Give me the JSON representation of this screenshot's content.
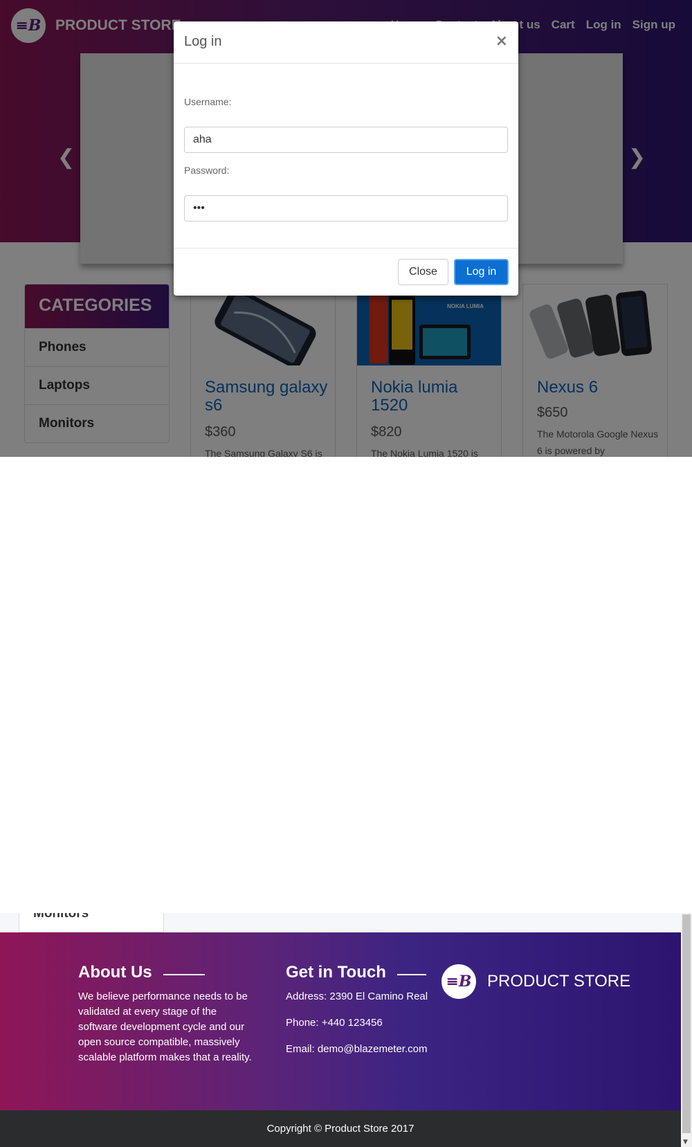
{
  "header": {
    "brand": "PRODUCT STORE",
    "nav": [
      "Home",
      "Contact",
      "About us",
      "Cart",
      "Log in",
      "Sign up"
    ]
  },
  "carousel": {
    "prev_icon": "chevron-left-icon",
    "next_icon": "chevron-right-icon"
  },
  "categories": {
    "title": "CATEGORIES",
    "items": [
      "Phones",
      "Laptops",
      "Monitors"
    ]
  },
  "products": [
    {
      "title": "Samsung galaxy s6",
      "price": "$360",
      "description": "The Samsung Galaxy S6 is"
    },
    {
      "title": "Nokia lumia 1520",
      "price": "$820",
      "description": "The Nokia Lumia 1520 is",
      "image_text": "NOKIA LUMIA"
    },
    {
      "title": "Nexus 6",
      "price": "$650",
      "description": "The Motorola Google Nexus 6 is powered by"
    }
  ],
  "modal": {
    "title": "Log in",
    "close_symbol": "×",
    "username_label": "Username:",
    "username_value": "aha",
    "password_label": "Password:",
    "password_value": "•••",
    "close_button": "Close",
    "login_button": "Log in"
  },
  "lower_fragment": {
    "text": "Monitors"
  },
  "footer": {
    "about_title": "About Us",
    "about_text": "We believe performance needs to be validated at every stage of the software development cycle and our open source compatible, massively scalable platform makes that a reality.",
    "contact_title": "Get in Touch",
    "address": "Address: 2390 El Camino Real",
    "phone": "Phone: +440 123456",
    "email": "Email: demo@blazemeter.com",
    "brand": "PRODUCT STORE",
    "copyright": "Copyright © Product Store 2017"
  },
  "colors": {
    "brand_start": "#8e1656",
    "brand_end": "#2e1672",
    "link_blue": "#0d63b8",
    "button_blue": "#0b6ed3"
  }
}
